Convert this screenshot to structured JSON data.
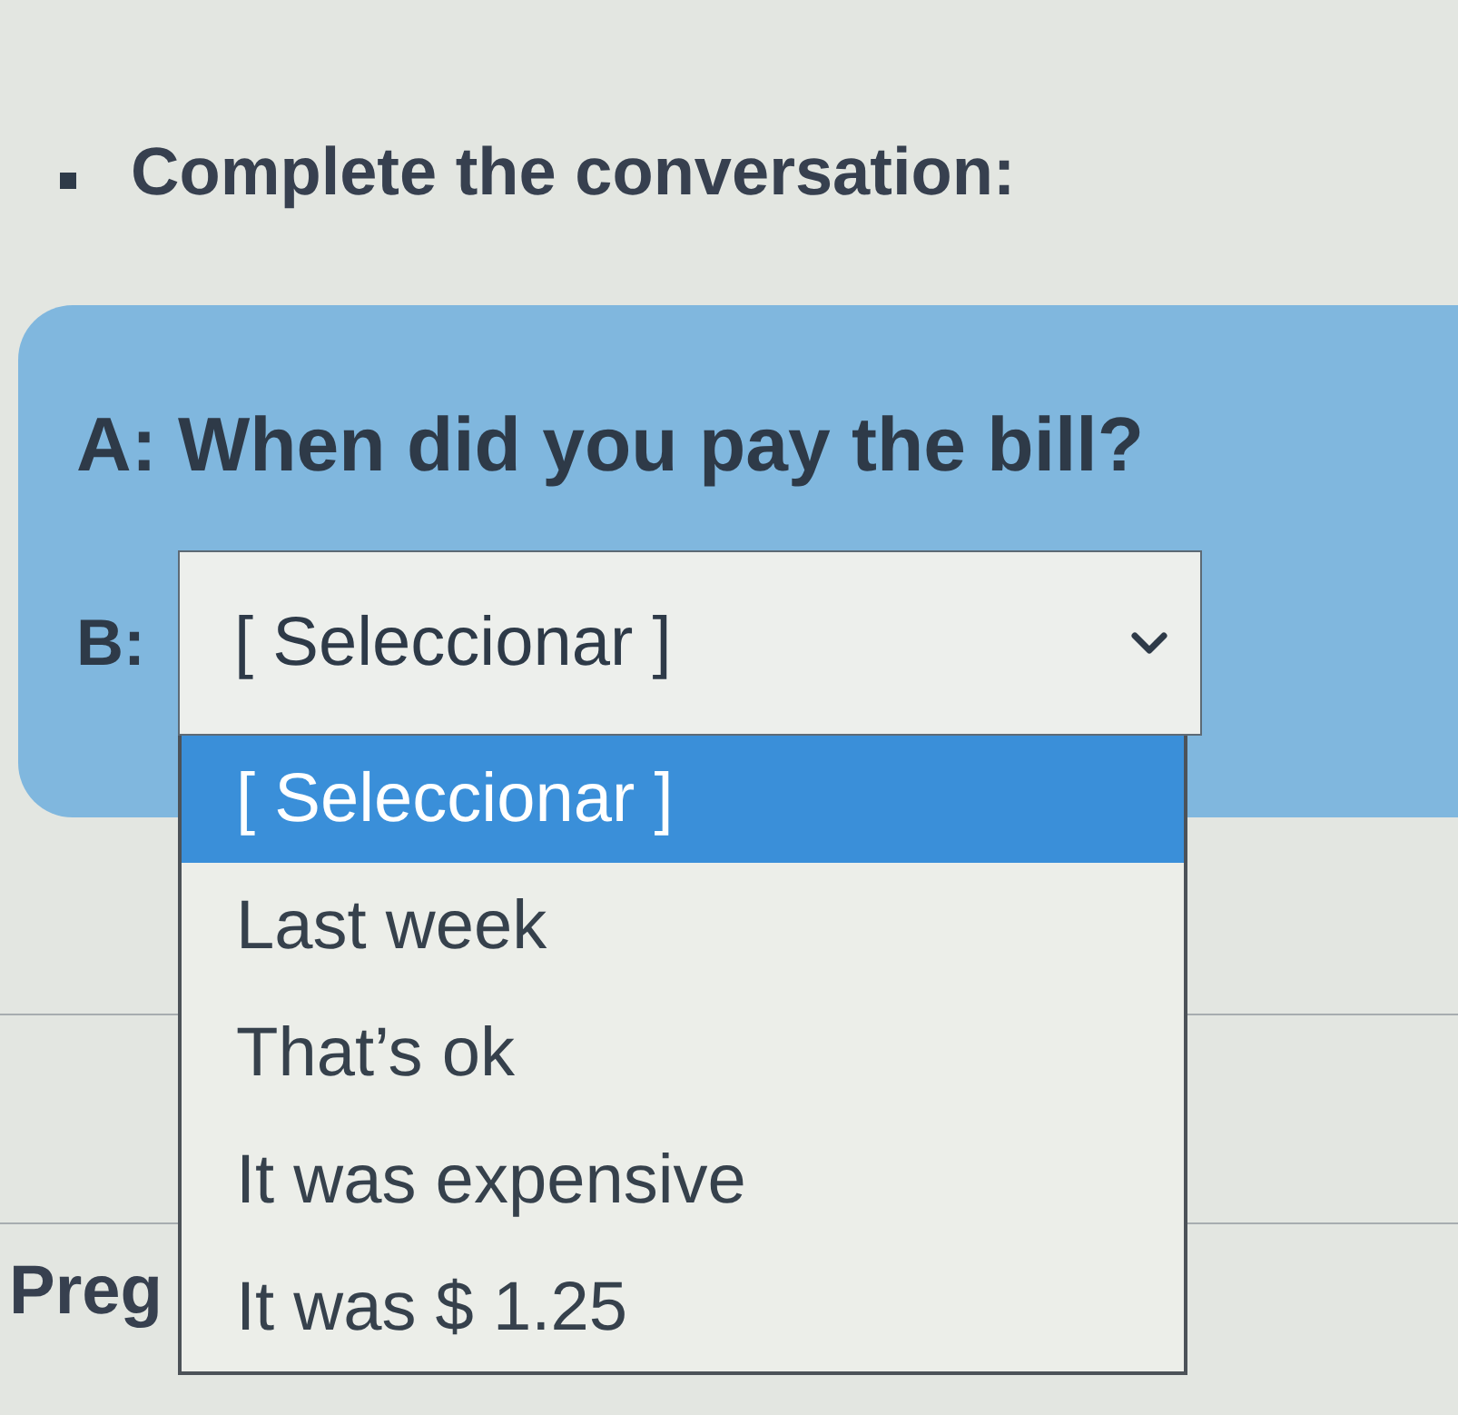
{
  "instruction": {
    "text": "Complete the conversation:"
  },
  "panel": {
    "question": "A: When did you pay the bill?",
    "answer_label": "B:",
    "select": {
      "value": "[ Seleccionar ]",
      "expanded": true,
      "options": [
        {
          "label": "[ Seleccionar ]",
          "selected": true
        },
        {
          "label": "Last week",
          "selected": false
        },
        {
          "label": "That’s ok",
          "selected": false
        },
        {
          "label": "It was expensive",
          "selected": false
        },
        {
          "label": "It was $ 1.25",
          "selected": false
        }
      ]
    }
  },
  "next_question": {
    "text": "Preg"
  }
}
